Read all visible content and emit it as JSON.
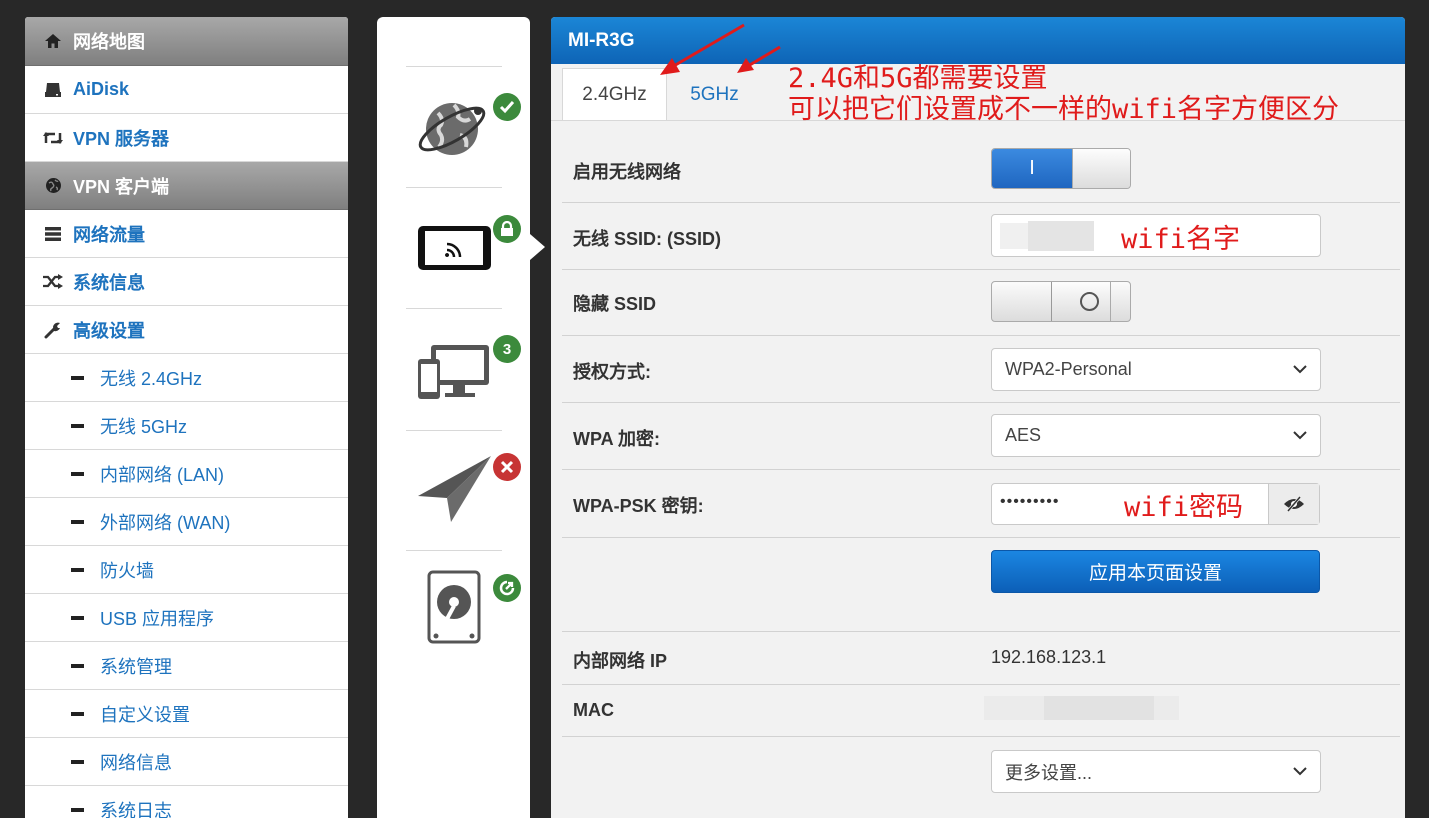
{
  "sidebar": {
    "items": [
      {
        "label": "网络地图",
        "icon": "home-icon"
      },
      {
        "label": "AiDisk",
        "icon": "hdd-icon"
      },
      {
        "label": "VPN 服务器",
        "icon": "retweet-icon"
      },
      {
        "label": "VPN 客户端",
        "icon": "globe-icon"
      },
      {
        "label": "网络流量",
        "icon": "tasks-icon"
      },
      {
        "label": "系统信息",
        "icon": "random-icon"
      },
      {
        "label": "高级设置",
        "icon": "wrench-icon"
      }
    ],
    "sub_items": [
      "无线 2.4GHz",
      "无线 5GHz",
      "内部网络 (LAN)",
      "外部网络 (WAN)",
      "防火墙",
      "USB 应用程序",
      "系统管理",
      "自定义设置",
      "网络信息",
      "系统日志"
    ]
  },
  "status": {
    "clients_count": "3"
  },
  "main": {
    "title": "MI-R3G",
    "tabs": [
      "2.4GHz",
      "5GHz"
    ],
    "fields": {
      "enable_label": "启用无线网络",
      "enable_on_text": "I",
      "ssid_label": "无线 SSID: (SSID)",
      "ssid_note": "wifi名字",
      "hide_label": "隐藏 SSID",
      "auth_label": "授权方式:",
      "auth_value": "WPA2-Personal",
      "enc_label": "WPA 加密:",
      "enc_value": "AES",
      "psk_label": "WPA-PSK 密钥:",
      "psk_value": "•••••••••",
      "psk_note": "wifi密码",
      "apply_label": "应用本页面设置",
      "lan_ip_label": "内部网络 IP",
      "lan_ip_value": "192.168.123.1",
      "mac_label": "MAC",
      "more_value": "更多设置..."
    }
  },
  "annotation": {
    "line1": "2.4G和5G都需要设置",
    "line2": "可以把它们设置成不一样的wifi名字方便区分"
  },
  "colors": {
    "accent": "#1e73be",
    "header": "#0e64b6",
    "annotation": "#e01b1b",
    "badge_green": "#3c8a3c",
    "badge_red": "#c73434"
  }
}
